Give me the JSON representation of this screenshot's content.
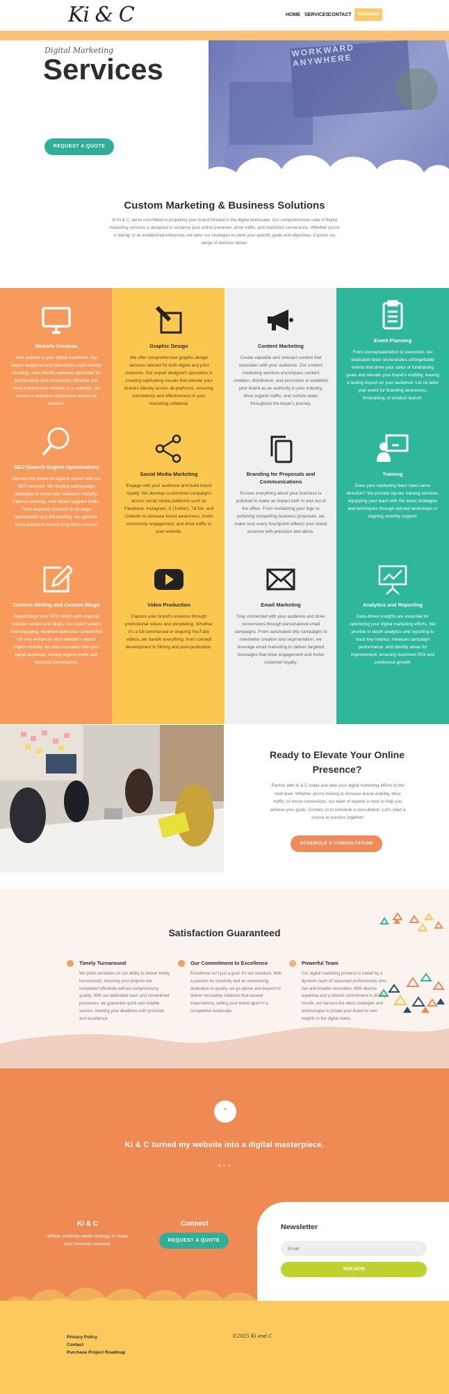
{
  "header": {
    "logo": "Ki & C",
    "nav": [
      "HOME",
      "SERVICES",
      "CONTACT"
    ],
    "roadmap": "ROADMAP"
  },
  "hero": {
    "subtitle": "Digital Marketing",
    "title": "Services",
    "button": "REQUEST A QUOTE",
    "image_text": "WORKWARD ANYWHERE"
  },
  "intro": {
    "title": "Custom Marketing & Business Solutions",
    "body": "At Ki & C, we're committed to propelling your brand forward in the digital landscape. Our comprehensive suite of digital marketing services is designed to enhance your online presence, drive traffic, and maximize conversions. Whether you're a startup or an established enterprise, we tailor our strategies to meet your specific goals and objectives. Explore our range of services below:"
  },
  "colors": {
    "orange": "#f79a5c",
    "yellow": "#fcc74e",
    "grey": "#f0f0f0",
    "teal": "#2fb79c"
  },
  "services": [
    {
      "title": "Website Creation",
      "icon": "monitor-icon",
      "desc": "Your website is your digital storefront. Our expert designers and developers craft visually stunning, user-friendly websites optimized for performance and conversion. Whether you need a brand-new website or a redesign, we ensure a seamless experience across all devices."
    },
    {
      "title": "Graphic Design",
      "icon": "pen-icon",
      "desc": "We offer comprehensive graphic design services tailored for both digital and print mediums. Our expert designers specialize in creating captivating visuals that elevate your brand's identity across all platforms, ensuring consistency and effectiveness in your marketing collateral."
    },
    {
      "title": "Content Marketing",
      "icon": "megaphone-icon",
      "desc": "Create valuable and relevant content that resonates with your audience. Our content marketing services encompass content creation, distribution, and promotion to establish your brand as an authority in your industry, drive organic traffic, and nurture leads throughout the buyer's journey."
    },
    {
      "title": "Event Planning",
      "icon": "clipboard-icon",
      "desc": "From conceptualization to execution, our dedicated team orchestrates unforgettable events that drive your sales or fundraising goals and elevate your brand's visibility, leaving a lasting impact on your audience. Let us tailor your event for branding awareness, fundraising, or product launch."
    },
    {
      "title": "SEO (Search Engine Optimization)",
      "icon": "search-icon",
      "desc": "Harness the power of organic search with our SEO services. We employ cutting-edge strategies to boost your website's visibility, improve rankings, and attract targeted traffic. From keyword research to on-page optimization and link building, we optimize every aspect to ensure long-term success."
    },
    {
      "title": "Social Media Marketing",
      "icon": "share-icon",
      "desc": "Engage with your audience and build brand loyalty. We develop customized campaigns across social media platforms such as Facebook, Instagram, X (Twitter), TikTok, and LinkedIn to increase brand awareness, foster community engagement, and drive traffic to your website."
    },
    {
      "title": "Branding for Proposals and Communications",
      "icon": "copy-icon",
      "desc": "Ensure everything about your business is polished to make an impact both in and out of the office. From revitalizing your logo to polishing compelling business proposals, we make sure every touchpoint reflects your brand essence with precision and allure."
    },
    {
      "title": "Training",
      "icon": "training-icon",
      "desc": "Does your marketing team need some direction? We provide top-tier training services, equipping your team with the latest strategies and techniques through tailored workshops or ongoing monthly support."
    },
    {
      "title": "Content Writing and Custom Blogs",
      "icon": "edit-icon",
      "desc": "Supercharge your SEO efforts with ongoing website content and blogs. Our expert writers craft engaging, keyword-optimized content that not only enhances your website's search engine visibility but also resonates with your target audience, driving organic traffic and boosting conversions."
    },
    {
      "title": "Video Production",
      "icon": "video-icon",
      "desc": "Capture your brand's essence through promotional videos and storytelling. Whether it's a full commercial or ongoing YouTube videos, we handle everything: from concept development to filming and post-production."
    },
    {
      "title": "Email Marketing",
      "icon": "envelope-icon",
      "desc": "Stay connected with your audience and drive conversions through personalized email campaigns. From automated drip campaigns to newsletter creation and segmentation, we leverage email marketing to deliver targeted messages that drive engagement and foster customer loyalty."
    },
    {
      "title": "Analytics and Reporting",
      "icon": "chart-icon",
      "desc": "Data-driven insights are essential for optimizing your digital marketing efforts. We provide in-depth analytics and reporting to track key metrics, measure campaign performance, and identify areas for improvement, ensuring maximum ROI and continuous growth."
    }
  ],
  "cta": {
    "title": "Ready to Elevate Your Online Presence?",
    "body": "Partner with Ki & C today and take your digital marketing efforts to the next level. Whether you're looking to increase brand visibility, drive traffic, or boost conversions, our team of experts is here to help you achieve your goals. Contact us to schedule a consultation. Let's chart a course to success together!",
    "button": "SCHEDULE A CONSULTATION"
  },
  "satisfaction": {
    "title": "Satisfaction Guaranteed",
    "features": [
      {
        "title": "Timely Turnaround",
        "desc": "We pride ourselves on our ability to deliver timely turnarounds, ensuring your projects are completed efficiently without compromising quality. With our dedicated team and streamlined processes, we guarantee quick and reliable service, meeting your deadlines with precision and excellence."
      },
      {
        "title": "Our Commitment to Excellence",
        "desc": "Excellence isn't just a goal; it's our standard. With a passion for creativity and an unwavering dedication to quality, we go above and beyond to deliver innovative solutions that exceed expectations, setting your brand apart in a competitive landscape."
      },
      {
        "title": "Powerful Team",
        "desc": "Our digital marketing prowess is fueled by a dynamic team of seasoned professionals who live and breathe innovation. With diverse expertise and a shared commitment to driving results, we harness the latest strategies and technologies to propel your brand to new heights in the digital realm."
      }
    ]
  },
  "testimonial": {
    "quote_mark": "”",
    "text": "Ki & C turned my website into a digital masterpiece."
  },
  "footer": {
    "brand": "Ki & C",
    "tagline": "Where creativity meets strategy to make your business succeed.",
    "connect": "Connect",
    "connect_button": "REQUEST A QUOTE",
    "newsletter": "Newsletter",
    "email_placeholder": "Email",
    "join": "JOIN NOW",
    "links": [
      "Privacy Policy",
      "Contact",
      "Purchase Project Roadmap"
    ],
    "copyright": "©2025 Ki and C"
  }
}
